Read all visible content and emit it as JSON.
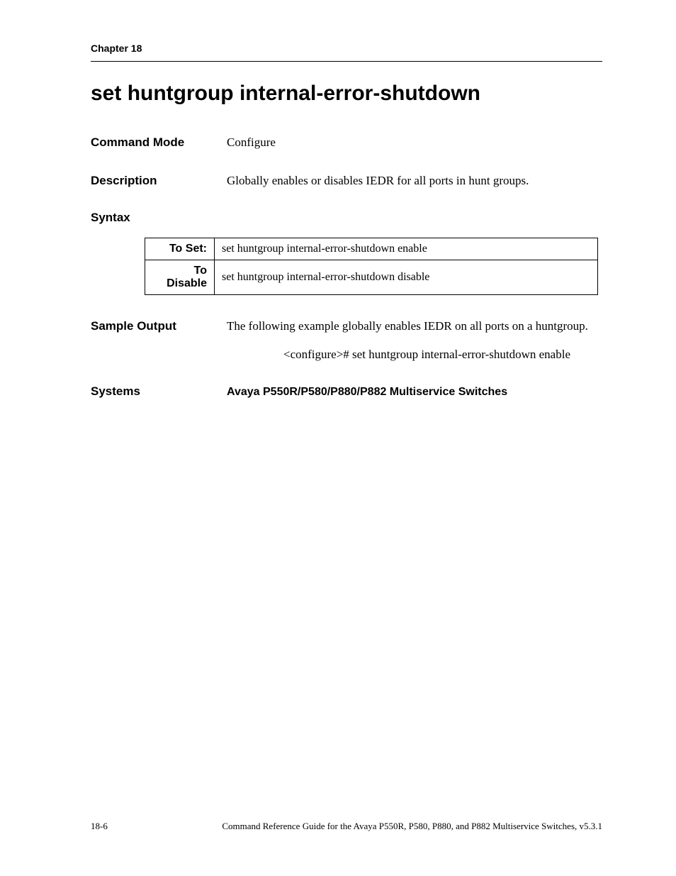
{
  "header": {
    "chapter": "Chapter 18"
  },
  "title": "set huntgroup internal-error-shutdown",
  "sections": {
    "command_mode": {
      "label": "Command Mode",
      "value": "Configure"
    },
    "description": {
      "label": "Description",
      "value": "Globally enables or disables IEDR for all ports in hunt groups."
    },
    "syntax": {
      "label": "Syntax",
      "rows": [
        {
          "label": "To Set:",
          "value": "set huntgroup internal-error-shutdown enable"
        },
        {
          "label": "To Disable",
          "value": "set huntgroup internal-error-shutdown disable"
        }
      ]
    },
    "sample_output": {
      "label": "Sample Output",
      "intro": "The following example globally enables IEDR on all ports on a huntgroup.",
      "example": "<configure># set huntgroup internal-error-shutdown enable"
    },
    "systems": {
      "label": "Systems",
      "value": "Avaya P550R/P580/P880/P882 Multiservice Switches"
    }
  },
  "footer": {
    "page": "18-6",
    "text": "Command Reference Guide for the Avaya P550R, P580, P880, and P882 Multiservice Switches, v5.3.1"
  }
}
